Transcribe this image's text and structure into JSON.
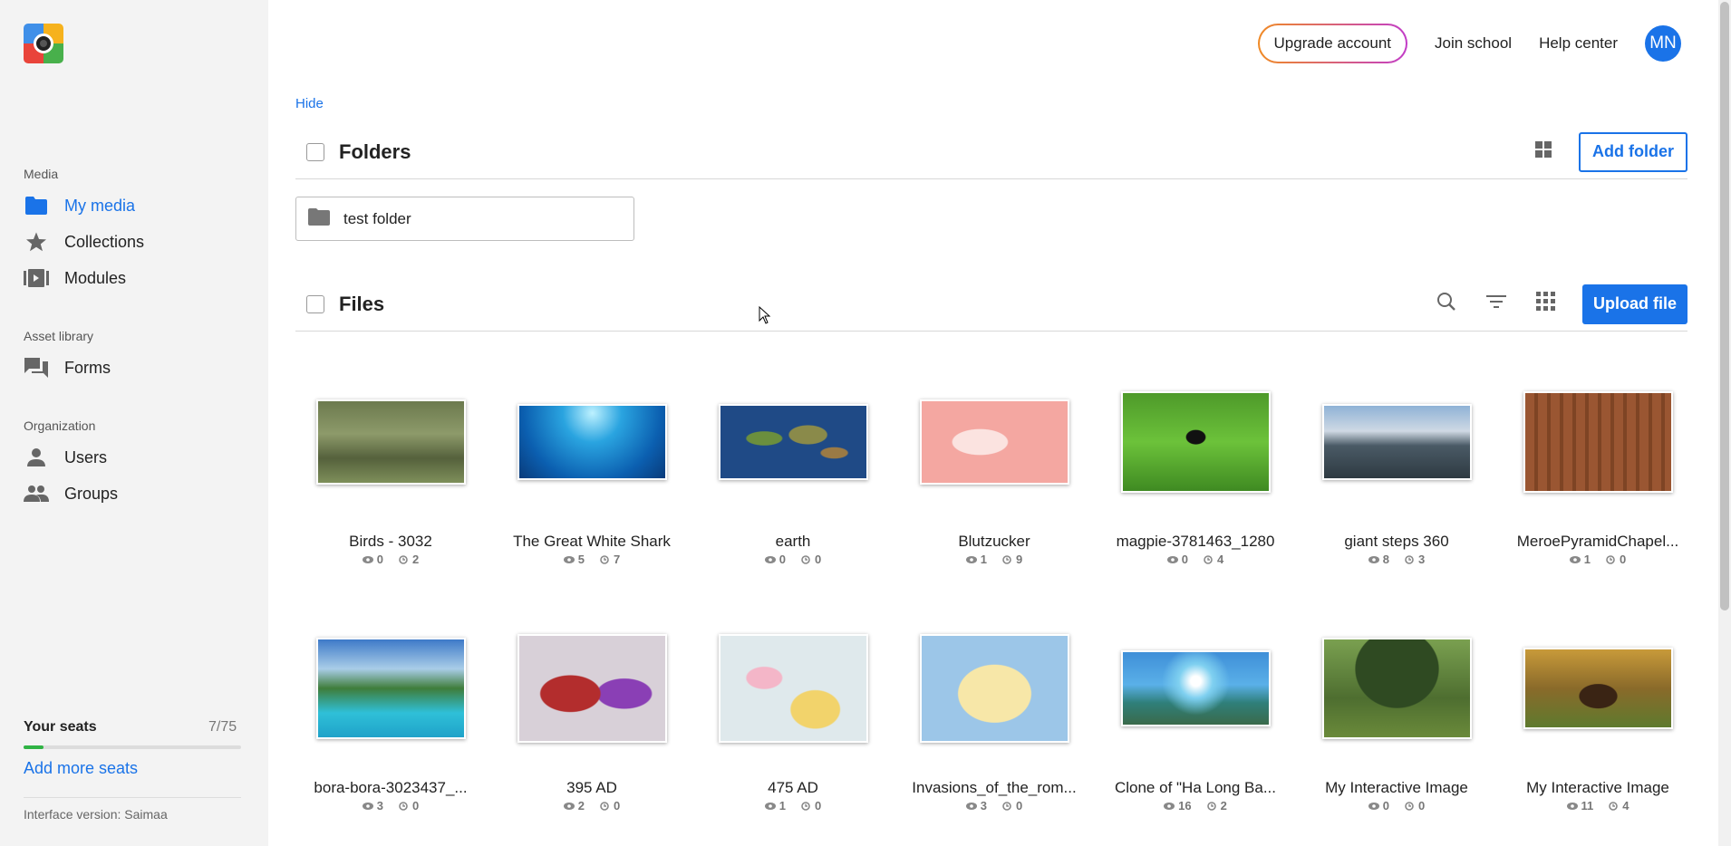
{
  "sidebar": {
    "sections": [
      {
        "label": "Media"
      },
      {
        "label": "Asset library"
      },
      {
        "label": "Organization"
      }
    ],
    "items": [
      {
        "label": "My media",
        "icon": "folder-icon",
        "active": true
      },
      {
        "label": "Collections",
        "icon": "star-icon"
      },
      {
        "label": "Modules",
        "icon": "modules-icon"
      },
      {
        "label": "Forms",
        "icon": "forms-icon"
      },
      {
        "label": "Users",
        "icon": "user-icon"
      },
      {
        "label": "Groups",
        "icon": "groups-icon"
      }
    ],
    "seats": {
      "title": "Your seats",
      "count": "7/75",
      "fraction": 0.093,
      "add_label": "Add more seats"
    },
    "interface_version": "Interface version: Saimaa"
  },
  "topbar": {
    "upgrade_label": "Upgrade account",
    "join_label": "Join school",
    "help_label": "Help center",
    "avatar_initials": "MN"
  },
  "colors": {
    "accent": "#1a73e8",
    "seats_fill": "#2fb344"
  },
  "hide_label": "Hide",
  "folders": {
    "title": "Folders",
    "add_label": "Add folder",
    "items": [
      {
        "label": "test folder"
      }
    ]
  },
  "files": {
    "title": "Files",
    "upload_label": "Upload file",
    "items": [
      {
        "name": "Birds - 3032",
        "views": "0",
        "stat2": "2",
        "thumb": "forest-birds"
      },
      {
        "name": "The Great White Shark",
        "views": "5",
        "stat2": "7",
        "thumb": "underwater"
      },
      {
        "name": "earth",
        "views": "0",
        "stat2": "0",
        "thumb": "world-map"
      },
      {
        "name": "Blutzucker",
        "views": "1",
        "stat2": "9",
        "thumb": "body-diagram"
      },
      {
        "name": "magpie-3781463_1280",
        "views": "0",
        "stat2": "4",
        "thumb": "magpie-grass"
      },
      {
        "name": "giant steps 360",
        "views": "8",
        "stat2": "3",
        "thumb": "panorama-coast"
      },
      {
        "name": "MeroePyramidChapel...",
        "views": "1",
        "stat2": "0",
        "thumb": "stone-relief"
      },
      {
        "name": "bora-bora-3023437_...",
        "views": "3",
        "stat2": "0",
        "thumb": "tropical-island"
      },
      {
        "name": "395 AD",
        "views": "2",
        "stat2": "0",
        "thumb": "roman-map-395"
      },
      {
        "name": "475 AD",
        "views": "1",
        "stat2": "0",
        "thumb": "europe-map-475"
      },
      {
        "name": "Invasions_of_the_rom...",
        "views": "3",
        "stat2": "0",
        "thumb": "invasions-map"
      },
      {
        "name": "Clone of \"Ha Long Ba...",
        "views": "16",
        "stat2": "2",
        "thumb": "bay-panorama"
      },
      {
        "name": "My Interactive Image",
        "views": "0",
        "stat2": "0",
        "thumb": "park-tree"
      },
      {
        "name": "My Interactive Image",
        "views": "11",
        "stat2": "4",
        "thumb": "bison"
      }
    ]
  }
}
